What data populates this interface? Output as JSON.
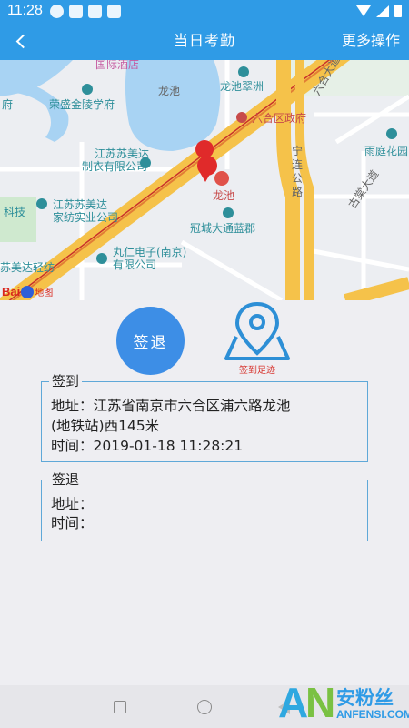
{
  "status_bar": {
    "time": "11:28"
  },
  "header": {
    "title": "当日考勤",
    "more_label": "更多操作"
  },
  "map": {
    "labels": [
      {
        "text": "国际酒店",
        "style": "pink"
      },
      {
        "text": "龙池",
        "style": "dark"
      },
      {
        "text": "龙池翠洲",
        "style": ""
      },
      {
        "text": "六合区政府",
        "style": "red"
      },
      {
        "text": "荣盛金陵学府",
        "style": ""
      },
      {
        "text": "雨庭花园",
        "style": ""
      },
      {
        "text": "江苏苏美达",
        "style": ""
      },
      {
        "text": "制衣有限公司",
        "style": ""
      },
      {
        "text": "宁",
        "style": "dark"
      },
      {
        "text": "连",
        "style": "dark"
      },
      {
        "text": "公",
        "style": "dark"
      },
      {
        "text": "路",
        "style": "dark"
      },
      {
        "text": "龙池",
        "style": "red"
      },
      {
        "text": "江苏苏美达",
        "style": ""
      },
      {
        "text": "家纺实业公司",
        "style": ""
      },
      {
        "text": "冠城大通蓝郡",
        "style": ""
      },
      {
        "text": "丸仁电子(南京)",
        "style": ""
      },
      {
        "text": "有限公司",
        "style": ""
      },
      {
        "text": "苏美达轻纺",
        "style": ""
      },
      {
        "text": "科技",
        "style": ""
      },
      {
        "text": "府",
        "style": ""
      },
      {
        "text": "六合大道",
        "style": "dark"
      },
      {
        "text": "古棠大道",
        "style": "dark"
      }
    ],
    "logo_text": "Bai",
    "logo_suffix": "地图"
  },
  "actions": {
    "signout_label": "签退",
    "track_label": "签到足迹"
  },
  "signin": {
    "title": "签到",
    "address_line1": "地址：江苏省南京市六合区浦六路龙池",
    "address_line2": "(地铁站)西145米",
    "time_line": "时间：2019-01-18 11:28:21"
  },
  "signout": {
    "title": "签退",
    "address_line": "地址：",
    "time_line": "时间："
  },
  "watermark": {
    "letter_a": "A",
    "letter_n": "N",
    "text_cn": "安粉丝",
    "text_en": "ANFENSI.COM"
  },
  "colors": {
    "primary": "#2f9be6",
    "signout_button": "#3d8ee6",
    "track_red": "#d7312b",
    "box_border": "#5fa8d8"
  }
}
